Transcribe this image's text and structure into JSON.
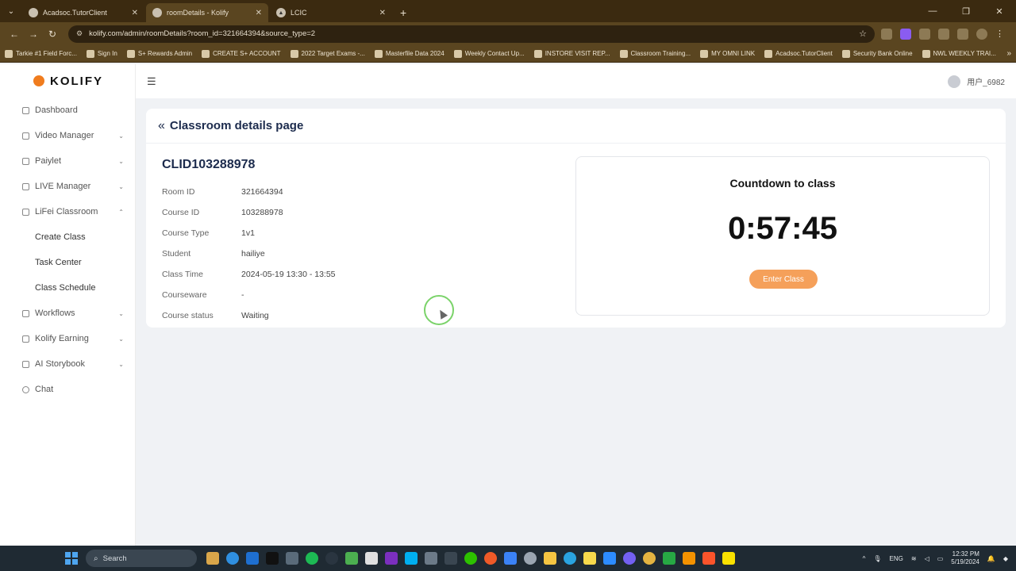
{
  "browser": {
    "tabs": [
      {
        "title": "Acadsoc.TutorClient",
        "active": false
      },
      {
        "title": "roomDetails - Kolify",
        "active": true
      },
      {
        "title": "LCIC",
        "active": false
      }
    ],
    "url": "kolify.com/admin/roomDetails?room_id=321664394&source_type=2",
    "bookmarks": [
      "Tarkie #1 Field Forc...",
      "Sign In",
      "S+ Rewards Admin",
      "CREATE S+ ACCOUNT",
      "2022 Target Exams -...",
      "Masterfile Data 2024",
      "Weekly Contact Up...",
      "INSTORE VISIT REP...",
      "Classroom Training...",
      "MY OMNI LINK",
      "Acadsoc.TutorClient",
      "Security Bank Online",
      "NWL WEEKLY TRAI..."
    ]
  },
  "app": {
    "logo": "KOLIFY",
    "user": "用户_6982",
    "menu": [
      {
        "label": "Dashboard",
        "chevron": ""
      },
      {
        "label": "Video Manager",
        "chevron": "⌄"
      },
      {
        "label": "Paiylet",
        "chevron": "⌄"
      },
      {
        "label": "LIVE Manager",
        "chevron": "⌄"
      },
      {
        "label": "LiFei Classroom",
        "chevron": "⌃"
      }
    ],
    "submenu": [
      "Create Class",
      "Task Center",
      "Class Schedule"
    ],
    "menu_after": [
      {
        "label": "Workflows",
        "chevron": "⌄"
      },
      {
        "label": "Kolify Earning",
        "chevron": "⌄"
      },
      {
        "label": "AI Storybook",
        "chevron": "⌄"
      },
      {
        "label": "Chat",
        "chevron": ""
      }
    ]
  },
  "page": {
    "title": "Classroom details page",
    "class_id": "CLID103288978",
    "fields": [
      {
        "key": "Room ID",
        "value": "321664394"
      },
      {
        "key": "Course ID",
        "value": "103288978"
      },
      {
        "key": "Course Type",
        "value": "1v1"
      },
      {
        "key": "Student",
        "value": "hailiye"
      },
      {
        "key": "Class Time",
        "value": "2024-05-19 13:30 - 13:55"
      },
      {
        "key": "Courseware",
        "value": "-"
      },
      {
        "key": "Course status",
        "value": "Waiting"
      }
    ],
    "countdown_title": "Countdown to class",
    "countdown": "0:57:45",
    "enter_button": "Enter Class"
  },
  "taskbar": {
    "search": "Search",
    "lang": "ENG",
    "time": "12:32 PM",
    "date": "5/19/2024"
  },
  "colors": {
    "accent": "#f5a05a",
    "title": "#1c2b4d",
    "browser": "#5a4520"
  }
}
